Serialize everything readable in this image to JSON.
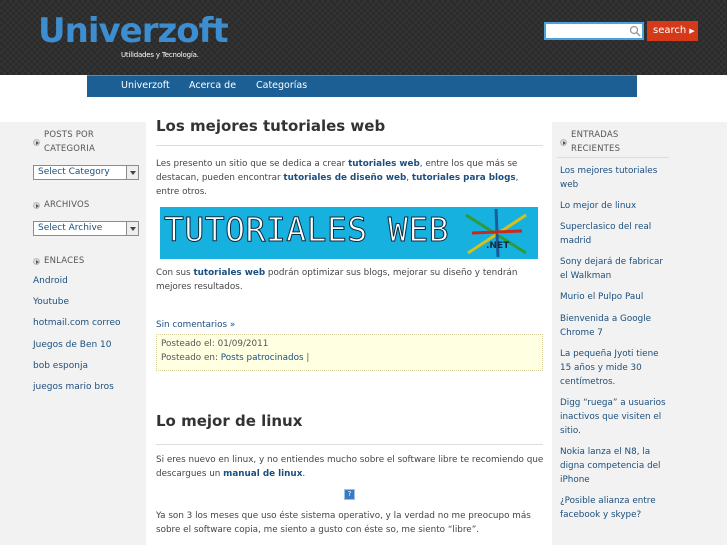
{
  "header": {
    "logo": "Univerzoft",
    "tagline": "Utilidades y Tecnología.",
    "search_placeholder": "",
    "search_button": "search"
  },
  "nav": {
    "items": [
      "Univerzoft",
      "Acerca de",
      "Categorías"
    ]
  },
  "left_sidebar": {
    "posts_heading": [
      "POSTS POR",
      "CATEGORIA"
    ],
    "category_select": "Select Category",
    "archive_heading": "ARCHIVOS",
    "archive_select": "Select Archive",
    "links_heading": "ENLACES",
    "links": [
      "Android",
      "Youtube",
      "hotmail.com correo",
      "Juegos de Ben 10",
      "bob esponja",
      "juegos mario bros"
    ]
  },
  "posts": [
    {
      "title": "Los mejores tutoriales web",
      "body_1": [
        "Les presento un sitio que se dedica a crear ",
        "tutoriales web",
        ", entre los que más se destacan, pueden encontrar ",
        "tutoriales de diseño web",
        ", ",
        "tutoriales para blogs",
        ", entre otros."
      ],
      "banner_text": "TUTORIALES WEB",
      "banner_sub": ".NET",
      "body_2": [
        "Con sus ",
        "tutoriales web",
        " podrán optimizar sus blogs, mejorar su diseño y tendrán mejores resultados."
      ],
      "comments": "Sin comentarios »",
      "posted_on_label": "Posteado el:",
      "posted_on": "01/09/2011",
      "posted_in_label": "Posteado en:",
      "posted_in": "Posts patrocinados",
      "posted_in_sep": "|"
    },
    {
      "title": "Lo mejor de linux",
      "body_1": [
        "Si eres nuevo en linux, y no entiendes mucho sobre el software libre te recomiendo que descargues un ",
        "manual de linux",
        "."
      ],
      "body_2": "Ya son 3 los meses que uso éste sistema operativo, y la verdad no me preocupo más sobre el software copia, me siento a gusto con éste so, me siento “libre”."
    }
  ],
  "right_sidebar": {
    "heading": [
      "ENTRADAS",
      "RECIENTES"
    ],
    "items": [
      [
        "Los mejores tutoriales",
        "web"
      ],
      [
        "Lo mejor de linux"
      ],
      [
        "Superclasico del real",
        "madrid"
      ],
      [
        "Sony dejará de fabricar",
        "el Walkman"
      ],
      [
        "Murio el Pulpo Paul"
      ],
      [
        "Bienvenida a Google",
        "Chrome 7"
      ],
      [
        "La pequeña Jyoti tiene",
        "15 años y mide 30",
        "centímetros."
      ],
      [
        "Digg “ruega” a usuarios",
        "inactivos que visiten el",
        "sitio."
      ],
      [
        "Nokia lanza el N8, la",
        "digna competencia del",
        "iPhone"
      ],
      [
        "¿Posible alianza entre",
        "facebook y skype?"
      ]
    ]
  },
  "colors": {
    "accent": "#1b5f94",
    "link": "#1b4f7e",
    "search_button": "#d43a1a",
    "logo": "#3d8ed0"
  }
}
